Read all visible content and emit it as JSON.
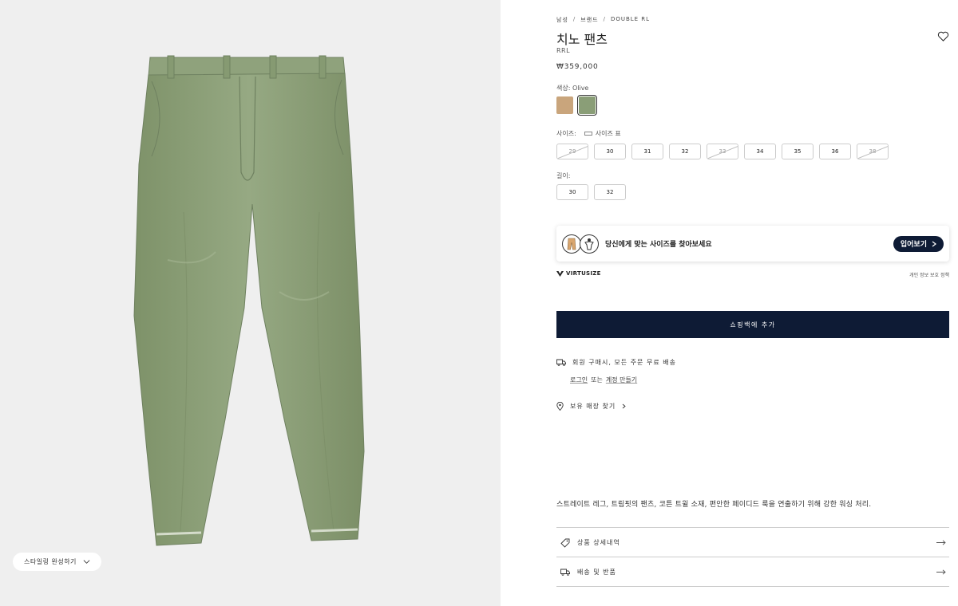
{
  "gallery": {
    "style_chip_label": "스타일링 완성하기"
  },
  "product": {
    "breadcrumb": [
      "남성",
      "브랜드",
      "DOUBLE RL"
    ],
    "title": "치노 팬츠",
    "brand": "RRL",
    "price": "₩359,000"
  },
  "color": {
    "label": "색상: Olive",
    "swatches": [
      {
        "name": "Khaki",
        "hex": "#c9a57c",
        "selected": false
      },
      {
        "name": "Olive",
        "hex": "#8a9e77",
        "selected": true
      }
    ]
  },
  "size": {
    "label": "사이즈:",
    "guide_label": "사이즈 표",
    "options": [
      {
        "label": "29",
        "available": false
      },
      {
        "label": "30",
        "available": true
      },
      {
        "label": "31",
        "available": true
      },
      {
        "label": "32",
        "available": true
      },
      {
        "label": "33",
        "available": false
      },
      {
        "label": "34",
        "available": true
      },
      {
        "label": "35",
        "available": true
      },
      {
        "label": "36",
        "available": true
      },
      {
        "label": "38",
        "available": false
      }
    ]
  },
  "length": {
    "label": "길이:",
    "options": [
      {
        "label": "30"
      },
      {
        "label": "32"
      }
    ]
  },
  "virtusize": {
    "prompt": "당신에게 맞는 사이즈를 찾아보세요",
    "button": "입어보기",
    "brand": "VIRTUSIZE",
    "privacy": "개인 정보 보호 정책"
  },
  "cart": {
    "button": "쇼핑백에 추가"
  },
  "shipping": {
    "text": "회원 구매시, 모든 주문 무료 배송",
    "login": "로그인",
    "or": "또는",
    "signup": "계정 만들기",
    "store": "보유 매장 찾기"
  },
  "description": "스트레이트 레그, 트림핏의 팬츠, 코튼 트윌 소재, 편안한 페이디드 룩을 연출하기 위해 강한 워싱 처리.",
  "accordion": [
    {
      "label": "상품 상세내역",
      "icon": "tag-icon"
    },
    {
      "label": "배송 및 반품",
      "icon": "truck-icon"
    }
  ],
  "colors": {
    "navy": "#0e1b35",
    "pants_olive": "#8a9e77",
    "image_bg": "#efefef"
  }
}
